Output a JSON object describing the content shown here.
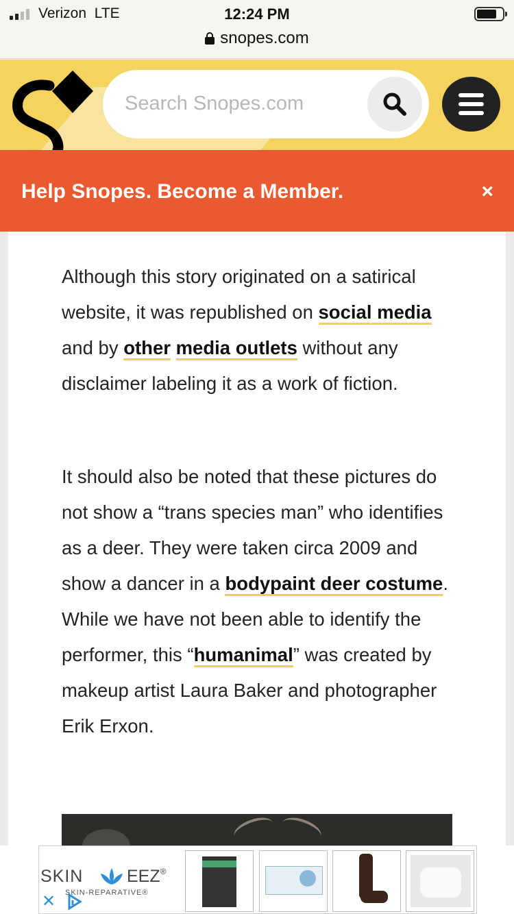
{
  "status_bar": {
    "carrier": "Verizon",
    "network": "LTE",
    "time": "12:24 PM",
    "url": "snopes.com"
  },
  "header": {
    "search_placeholder": "Search Snopes.com",
    "logo_icon": "snopes-logo-icon",
    "search_icon": "search-icon",
    "menu_icon": "hamburger-menu-icon",
    "brand_color": "#f4d35e"
  },
  "banner": {
    "text": "Help Snopes. Become a Member.",
    "close_label": "×",
    "color": "#ea5a30"
  },
  "article": {
    "p1": {
      "t1": "Although this story originated on a satirical website, it was republished on ",
      "link1": "social media",
      "t2": " and by ",
      "link2": "other",
      "t3": " ",
      "link3": "media outlets",
      "t4": " without any disclaimer labeling it as a work of fiction."
    },
    "p2": {
      "t1": "It should also be noted that these pictures do not show a “trans species man” who identifies as a deer. They were taken circa 2009 and show a dancer in a ",
      "link1": "bodypaint deer costume",
      "t2": ". While we have not been able to identify the performer, this “",
      "link2": "humanimal",
      "t3": "” was created by makeup artist Laura Baker and photographer Erik Erxon."
    },
    "link_underline_color": "#f0d060"
  },
  "ad": {
    "brand_left": "SKIN",
    "brand_right": "EEZ",
    "registered": "®",
    "tagline": "SKIN-REPARATIVE®",
    "close_label": "✕"
  }
}
